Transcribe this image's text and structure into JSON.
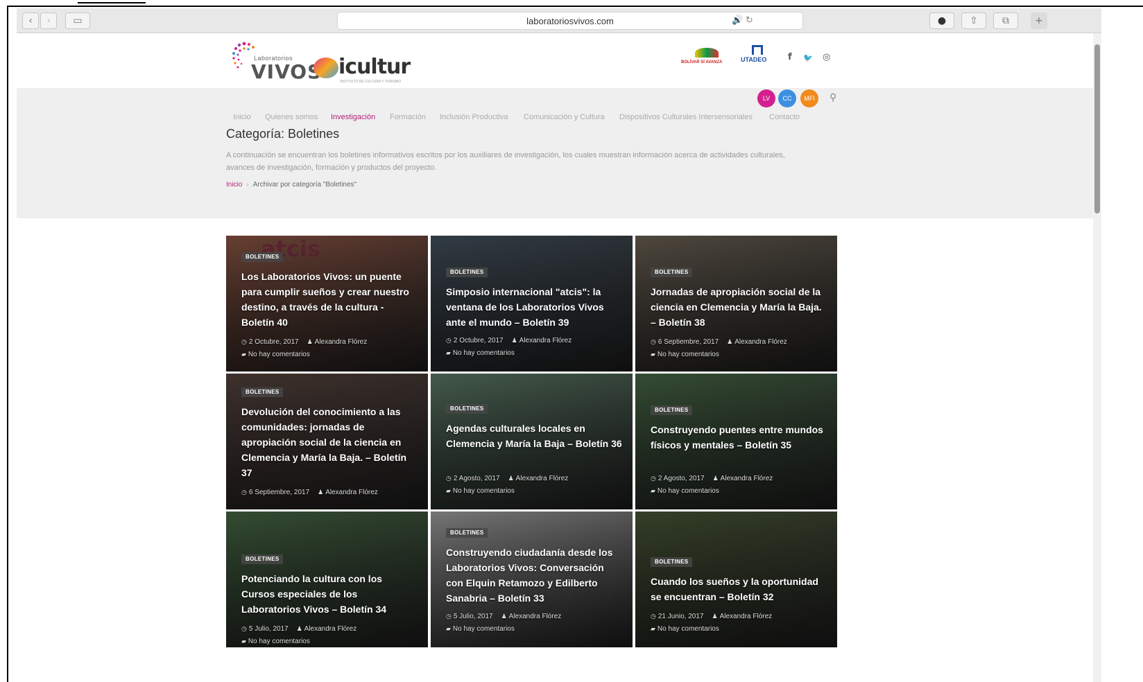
{
  "browser": {
    "url": "laboratoriosvivos.com",
    "back_icon": "‹",
    "forward_icon": "›",
    "sidebar_icon": "▭",
    "audio_icon": "🔊",
    "reload_icon": "↻",
    "download_icon": "●",
    "share_icon": "⇧",
    "tabs_icon": "⧉",
    "newtab_icon": "+"
  },
  "header": {
    "logo_small": "Laboratorios",
    "logo_big": "VIVOS",
    "icultur": "icultur",
    "icultur_sub": "INSTITUTO DE CULTURA Y TURISMO",
    "bolivar": "BOLÍVAR SÍ AVANZA",
    "tadeo": "UTADEO",
    "social": [
      "f",
      "🐦",
      "◎"
    ],
    "circles": [
      {
        "label": "LV",
        "color": "#d4208f"
      },
      {
        "label": "CC",
        "color": "#3d8fe0"
      },
      {
        "label": "MFI",
        "color": "#f28a1c"
      }
    ],
    "search_icon": "⚲"
  },
  "nav": {
    "items": [
      {
        "label": "Inicio",
        "active": false
      },
      {
        "label": "Quienes somos",
        "active": false
      },
      {
        "label": "Investigación",
        "active": true
      },
      {
        "label": "Formación",
        "active": false
      },
      {
        "label": "Inclusión Productiva",
        "active": false
      },
      {
        "label": "Comunicación y Cultura",
        "active": false
      },
      {
        "label": "Dispositivos Culturales Intersensoriales",
        "active": false
      },
      {
        "label": "Contacto",
        "active": false
      }
    ]
  },
  "category": {
    "title": "Categoría: Boletines",
    "description": "A continuación se encuentran los boletines informativos escritos por los auxiliares de investigación, los cuales muestran información acerca de actividades culturales, avances de investigación, formación y productos del proyecto.",
    "breadcrumb_home": "Inicio",
    "breadcrumb_sep": "›",
    "breadcrumb_current": "Archivar por categoría \"Boletines\""
  },
  "atcis_text": "atcis",
  "cards": [
    {
      "badge": "BOLETINES",
      "title": "Los Laboratorios Vivos: un puente para cumplir sueños y crear nuestro destino, a través de la cultura - Boletín 40",
      "date": "2 Octubre, 2017",
      "author": "Alexandra Flórez",
      "comments": "No hay comentarios",
      "bg": "#7a4a3a"
    },
    {
      "badge": "BOLETINES",
      "title": "Simposio internacional \"atcis\": la ventana de los Laboratorios Vivos ante el mundo – Boletín 39",
      "date": "2 Octubre, 2017",
      "author": "Alexandra Flórez",
      "comments": "No hay comentarios",
      "bg": "#3a4650"
    },
    {
      "badge": "BOLETINES",
      "title": "Jornadas de apropiación social de la ciencia en Clemencia y María la Baja. – Boletín 38",
      "date": "6 Septiembre, 2017",
      "author": "Alexandra Flórez",
      "comments": "No hay comentarios",
      "bg": "#5c5448"
    },
    {
      "badge": "BOLETINES",
      "title": "Devolución del conocimiento a las comunidades: jornadas de apropiación social de la ciencia en Clemencia y María la Baja. – Boletín 37",
      "date": "6 Septiembre, 2017",
      "author": "Alexandra Flórez",
      "comments": "",
      "bg": "#4a3a34"
    },
    {
      "badge": "BOLETINES",
      "title": "Agendas culturales locales en Clemencia y María la Baja – Boletín 36",
      "date": "2 Agosto, 2017",
      "author": "Alexandra Flórez",
      "comments": "No hay comentarios",
      "bg": "#4f6a58"
    },
    {
      "badge": "BOLETINES",
      "title": "Construyendo puentes entre mundos físicos y mentales – Boletín 35",
      "date": "2 Agosto, 2017",
      "author": "Alexandra Flórez",
      "comments": "No hay comentarios",
      "bg": "#3d5a3c"
    },
    {
      "badge": "BOLETINES",
      "title": "Potenciando la cultura con los Cursos especiales de los Laboratorios Vivos – Boletín 34",
      "date": "5 Julio, 2017",
      "author": "Alexandra Flórez",
      "comments": "No hay comentarios",
      "bg": "#3c5a3a"
    },
    {
      "badge": "BOLETINES",
      "title": "Construyendo ciudadanía desde los Laboratorios Vivos: Conversación con Elquin Retamozo y Edilberto Sanabria – Boletín 33",
      "date": "5 Julio, 2017",
      "author": "Alexandra Flórez",
      "comments": "No hay comentarios",
      "bg": "#8a8a8a"
    },
    {
      "badge": "BOLETINES",
      "title": "Cuando los sueños y la oportunidad se encuentran – Boletín 32",
      "date": "21 Junio, 2017",
      "author": "Alexandra Flórez",
      "comments": "No hay comentarios",
      "bg": "#3e4a2e"
    }
  ]
}
